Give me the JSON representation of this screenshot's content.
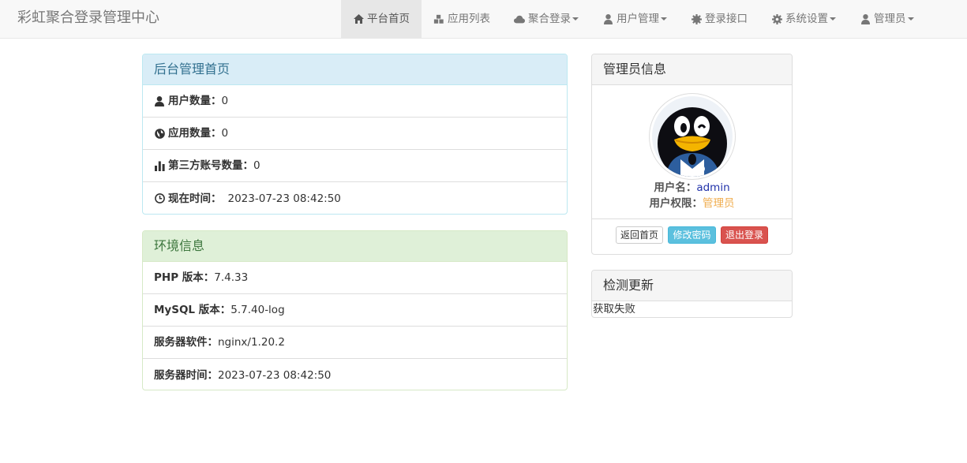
{
  "brand": "彩虹聚合登录管理中心",
  "nav": [
    {
      "label": "平台首页",
      "icon": "home-icon",
      "dropdown": false,
      "active": true
    },
    {
      "label": "应用列表",
      "icon": "cubes-icon",
      "dropdown": false,
      "active": false
    },
    {
      "label": "聚合登录",
      "icon": "cloud-icon",
      "dropdown": true,
      "active": false
    },
    {
      "label": "用户管理",
      "icon": "user-icon",
      "dropdown": true,
      "active": false
    },
    {
      "label": "登录接口",
      "icon": "cog-icon",
      "dropdown": false,
      "active": false
    },
    {
      "label": "系统设置",
      "icon": "gear-icon",
      "dropdown": true,
      "active": false
    },
    {
      "label": "管理员",
      "icon": "user-icon",
      "dropdown": true,
      "active": false
    }
  ],
  "dashboard": {
    "title": "后台管理首页",
    "rows": [
      {
        "icon": "user-icon",
        "label": "用户数量：",
        "value": "0"
      },
      {
        "icon": "globe-icon",
        "label": "应用数量：",
        "value": "0"
      },
      {
        "icon": "bar-chart-icon",
        "label": "第三方账号数量：",
        "value": "0"
      },
      {
        "icon": "clock-icon",
        "label": "现在时间：",
        "value": "2023-07-23 08:42:50"
      }
    ]
  },
  "env": {
    "title": "环境信息",
    "rows": [
      {
        "label": "PHP 版本：",
        "value": "7.4.33"
      },
      {
        "label": "MySQL 版本：",
        "value": "5.7.40-log"
      },
      {
        "label": "服务器软件：",
        "value": "nginx/1.20.2"
      },
      {
        "label": "服务器时间：",
        "value": "2023-07-23 08:42:50"
      }
    ]
  },
  "admin": {
    "title": "管理员信息",
    "username_label": "用户名：",
    "username": "admin",
    "role_label": "用户权限：",
    "role": "管理员",
    "buttons": {
      "home": "返回首页",
      "change_pwd": "修改密码",
      "logout": "退出登录"
    },
    "colors": {
      "username": "#2233aa",
      "role": "#f0ad4e"
    }
  },
  "update": {
    "title": "检测更新",
    "status": "获取失败"
  }
}
